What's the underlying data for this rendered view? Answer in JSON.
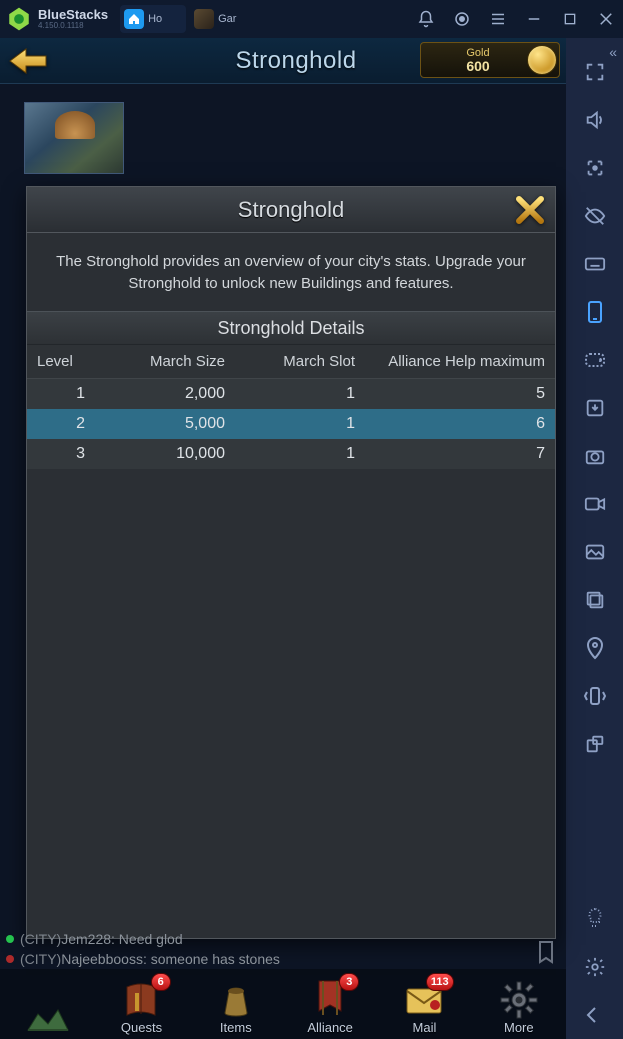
{
  "bluestacks": {
    "brand": "BlueStacks",
    "version": "4.150.0.1118",
    "tabs": [
      {
        "label": "Ho",
        "icon": "house",
        "color": "#1e9af0"
      },
      {
        "label": "Gar",
        "icon": "game",
        "color": "#3a3a3a"
      }
    ]
  },
  "game_header": {
    "page_title": "Stronghold",
    "gold_label": "Gold",
    "gold_value": "600"
  },
  "modal": {
    "title": "Stronghold",
    "description": "The Stronghold provides an overview of your city's stats. Upgrade your Stronghold to unlock new Buildings and features.",
    "table_title": "Stronghold Details",
    "columns": [
      "Level",
      "March Size",
      "March Slot",
      "Alliance Help maximum"
    ],
    "rows": [
      {
        "level": "1",
        "march_size": "2,000",
        "march_slot": "1",
        "help": "5",
        "highlight": false
      },
      {
        "level": "2",
        "march_size": "5,000",
        "march_slot": "1",
        "help": "6",
        "highlight": true
      },
      {
        "level": "3",
        "march_size": "10,000",
        "march_slot": "1",
        "help": "7",
        "highlight": false
      }
    ]
  },
  "chat": [
    {
      "color": "green",
      "tag": "(CITY)",
      "name": "Jem228",
      "msg": "Need glod"
    },
    {
      "color": "red",
      "tag": "(CITY)",
      "name": "Najeebbooss",
      "msg": "someone has stones"
    }
  ],
  "bottom_menu": [
    {
      "label": "",
      "badge": "",
      "icon": "city"
    },
    {
      "label": "Quests",
      "badge": "6",
      "icon": "book"
    },
    {
      "label": "Items",
      "badge": "",
      "icon": "bag"
    },
    {
      "label": "Alliance",
      "badge": "3",
      "icon": "banner"
    },
    {
      "label": "Mail",
      "badge": "113",
      "icon": "mail"
    },
    {
      "label": "More",
      "badge": "",
      "icon": "gear"
    }
  ]
}
